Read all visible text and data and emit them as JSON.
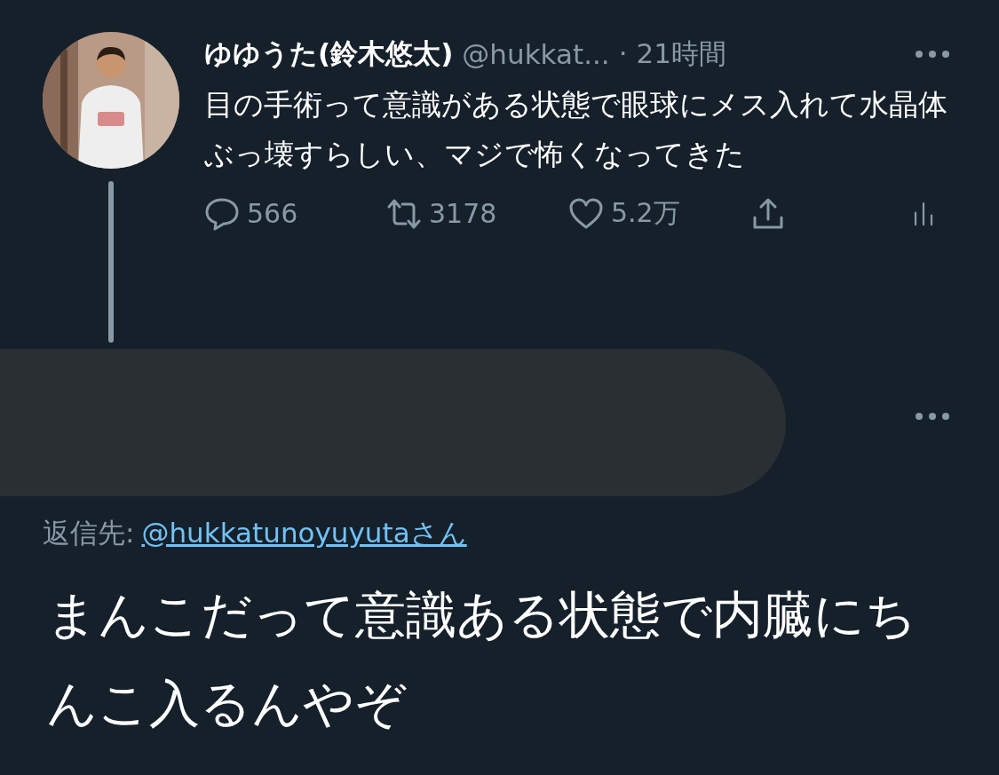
{
  "tweet": {
    "display_name": "ゆゆうた(鈴木悠太)",
    "handle": "@hukkat...",
    "time": "· 21時間",
    "text": "目の手術って意識がある状態で眼球にメス入れて水晶体ぶっ壊すらしい、マジで怖くなってきた",
    "actions": [
      {
        "kind": "reply",
        "count": "566"
      },
      {
        "kind": "retweet",
        "count": "3178"
      },
      {
        "kind": "like",
        "count": "5.2万"
      },
      {
        "kind": "share"
      },
      {
        "kind": "analytics"
      }
    ]
  },
  "reply": {
    "author_redacted": true,
    "reply_to_label": "返信先:",
    "reply_to_link": "@hukkatunoyuyutaさん",
    "text": "まんこだって意識ある状態で内臓にちんこ入るんやぞ"
  }
}
